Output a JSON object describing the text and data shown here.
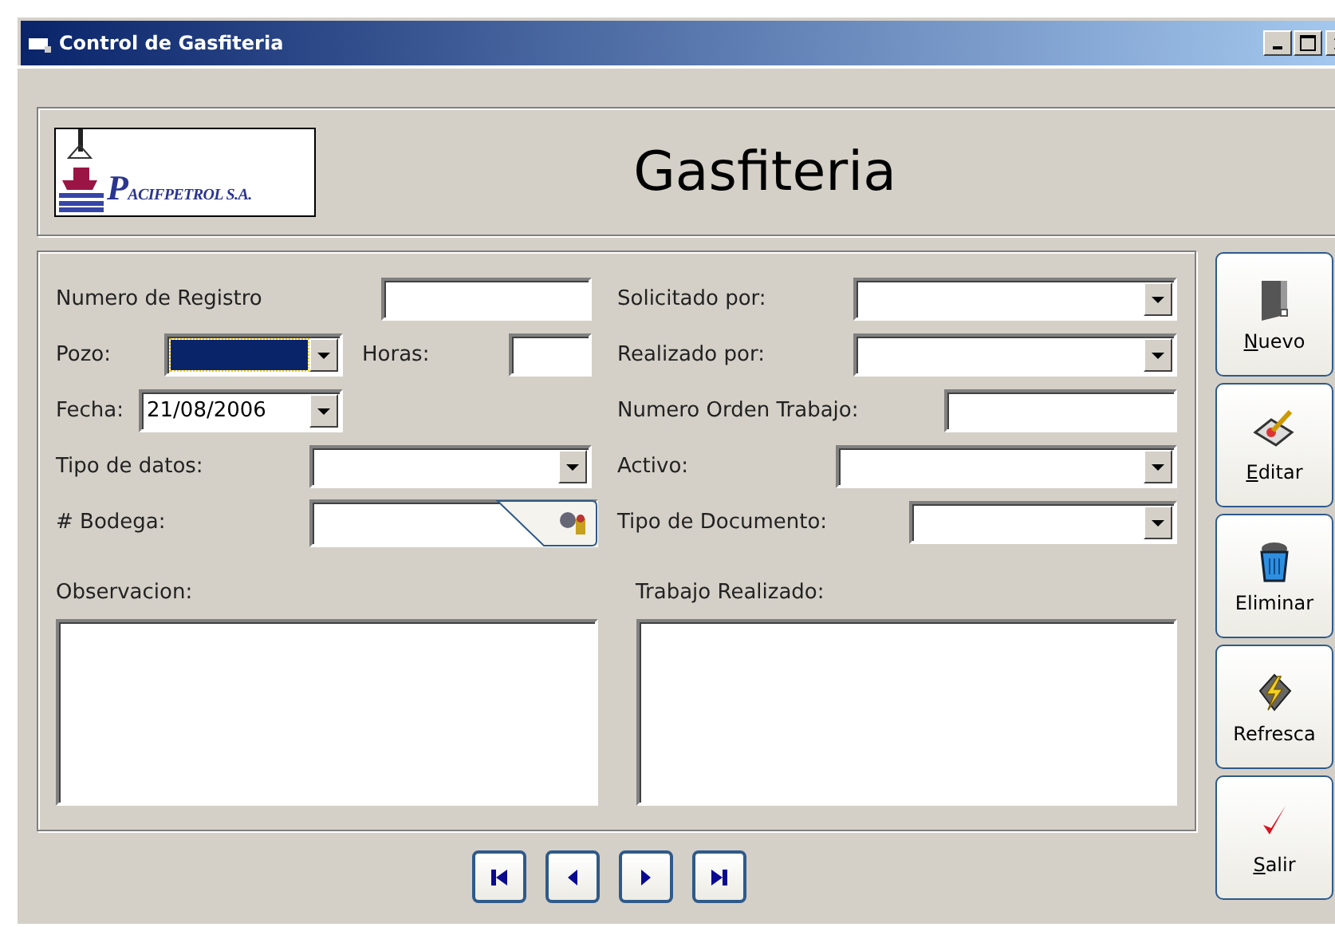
{
  "window": {
    "title": "Control de Gasfiteria"
  },
  "header": {
    "logo_text": "PACIFPETROL S.A.",
    "title": "Gasfiteria"
  },
  "left_fields": [
    {
      "label": "Numero de Registro",
      "kind": "text"
    },
    {
      "label": "Pozo:",
      "kind": "combo",
      "focused": true
    },
    {
      "label": "Horas:",
      "kind": "text"
    },
    {
      "label": "Fecha:",
      "kind": "date",
      "value": "21/08/2006"
    },
    {
      "label": "Tipo de datos:",
      "kind": "combo"
    },
    {
      "label": "# Bodega:",
      "kind": "lookup"
    }
  ],
  "right_fields": [
    {
      "label": "Solicitado por:",
      "kind": "combo"
    },
    {
      "label": "Realizado por:",
      "kind": "combo"
    },
    {
      "label": "Numero Orden Trabajo:",
      "kind": "text"
    },
    {
      "label": "Activo:",
      "kind": "combo"
    },
    {
      "label": "Tipo de Documento:",
      "kind": "combo"
    }
  ],
  "notes": [
    {
      "label": "Observacion:"
    },
    {
      "label": "Trabajo Realizado:"
    }
  ],
  "nav_buttons": [
    {
      "kind": "first"
    },
    {
      "kind": "prev"
    },
    {
      "kind": "next"
    },
    {
      "kind": "last"
    }
  ],
  "action_buttons": [
    {
      "label": "Nuevo",
      "kind": "new",
      "access_key": true
    },
    {
      "label": "Editar",
      "kind": "edit",
      "access_key": true
    },
    {
      "label": "Eliminar",
      "kind": "delete",
      "access_key": false
    },
    {
      "label": "Refresca",
      "kind": "refresh",
      "access_key": false
    },
    {
      "label": "Salir",
      "kind": "exit",
      "access_key": true
    }
  ]
}
